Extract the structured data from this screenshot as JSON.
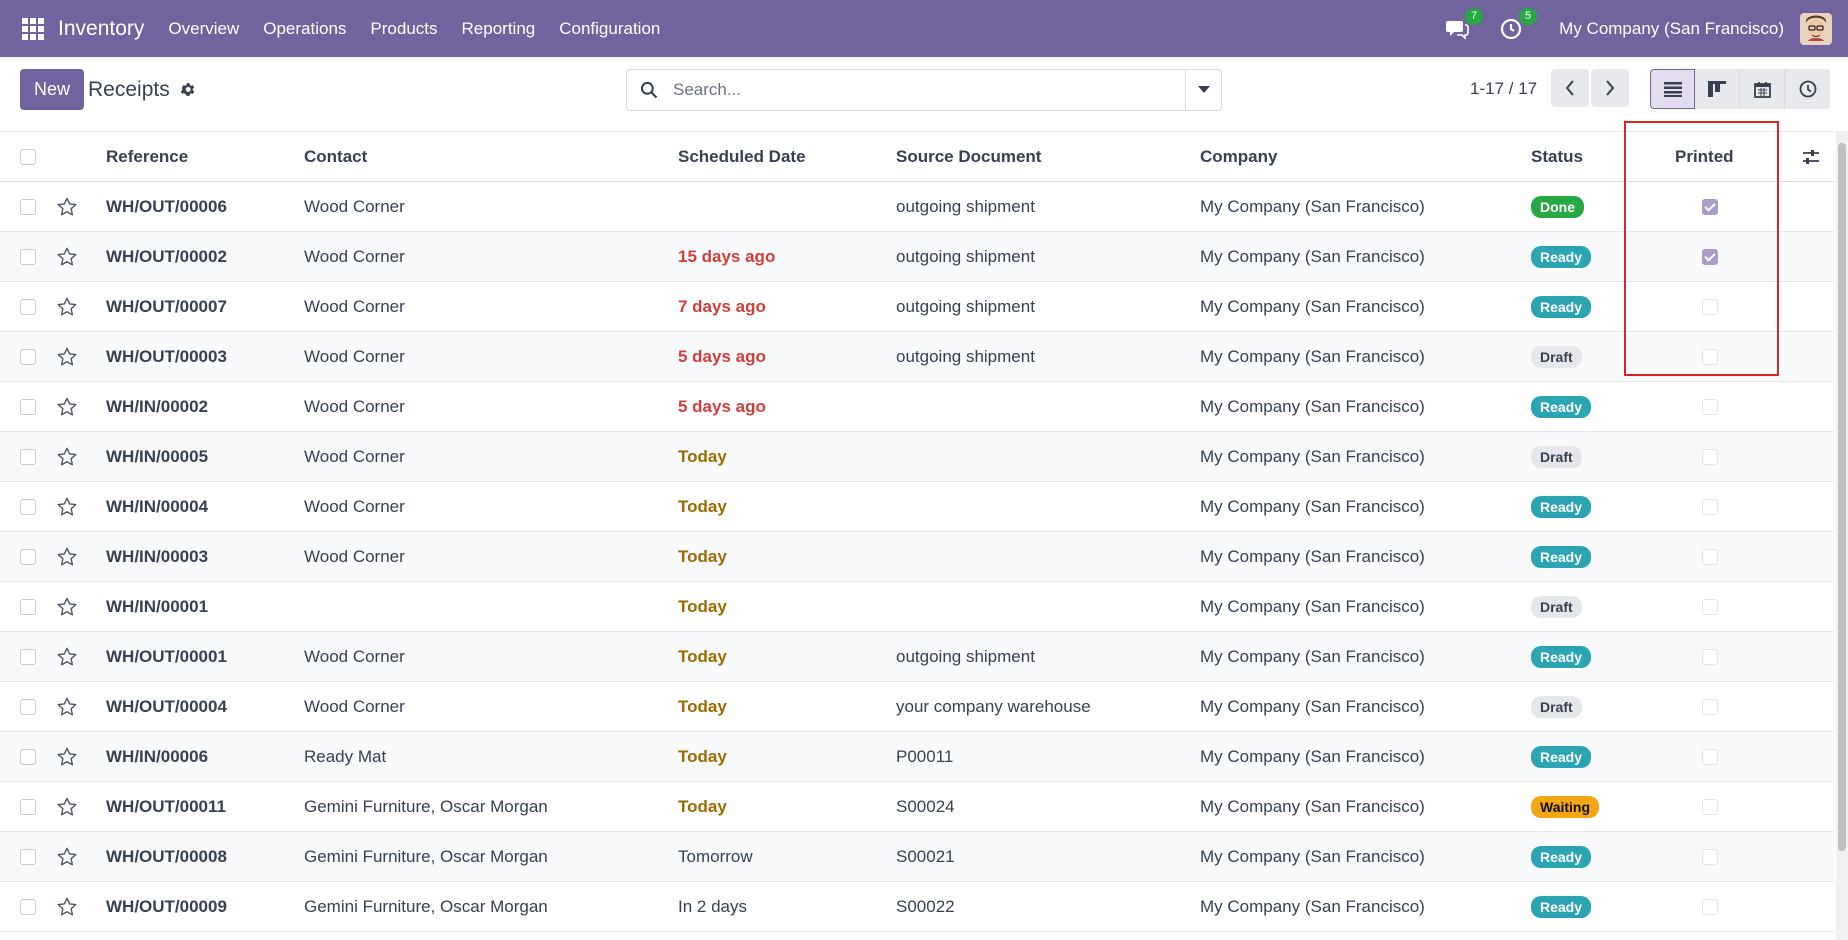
{
  "nav": {
    "app_name": "Inventory",
    "menu": [
      "Overview",
      "Operations",
      "Products",
      "Reporting",
      "Configuration"
    ],
    "messages_count": "7",
    "activities_count": "5",
    "company": "My Company (San Francisco)"
  },
  "control": {
    "new_label": "New",
    "title": "Receipts",
    "search_placeholder": "Search...",
    "pager": "1-17 / 17"
  },
  "columns": {
    "reference": "Reference",
    "contact": "Contact",
    "scheduled_date": "Scheduled Date",
    "source_document": "Source Document",
    "company": "Company",
    "status": "Status",
    "printed": "Printed"
  },
  "colors": {
    "brand": "#71639e",
    "done": "#28a745",
    "ready": "#2ba4b4",
    "waiting": "#f3a712",
    "late": "#d23f3a",
    "today": "#9b6b00"
  },
  "rows": [
    {
      "reference": "WH/OUT/00006",
      "contact": "Wood Corner",
      "date": "",
      "date_type": "none",
      "source": "outgoing shipment",
      "company": "My Company (San Francisco)",
      "status": "Done",
      "printed": true
    },
    {
      "reference": "WH/OUT/00002",
      "contact": "Wood Corner",
      "date": "15 days ago",
      "date_type": "late",
      "source": "outgoing shipment",
      "company": "My Company (San Francisco)",
      "status": "Ready",
      "printed": true
    },
    {
      "reference": "WH/OUT/00007",
      "contact": "Wood Corner",
      "date": "7 days ago",
      "date_type": "late",
      "source": "outgoing shipment",
      "company": "My Company (San Francisco)",
      "status": "Ready",
      "printed": false
    },
    {
      "reference": "WH/OUT/00003",
      "contact": "Wood Corner",
      "date": "5 days ago",
      "date_type": "late",
      "source": "outgoing shipment",
      "company": "My Company (San Francisco)",
      "status": "Draft",
      "printed": false
    },
    {
      "reference": "WH/IN/00002",
      "contact": "Wood Corner",
      "date": "5 days ago",
      "date_type": "late",
      "source": "",
      "company": "My Company (San Francisco)",
      "status": "Ready",
      "printed": false
    },
    {
      "reference": "WH/IN/00005",
      "contact": "Wood Corner",
      "date": "Today",
      "date_type": "today",
      "source": "",
      "company": "My Company (San Francisco)",
      "status": "Draft",
      "printed": false
    },
    {
      "reference": "WH/IN/00004",
      "contact": "Wood Corner",
      "date": "Today",
      "date_type": "today",
      "source": "",
      "company": "My Company (San Francisco)",
      "status": "Ready",
      "printed": false
    },
    {
      "reference": "WH/IN/00003",
      "contact": "Wood Corner",
      "date": "Today",
      "date_type": "today",
      "source": "",
      "company": "My Company (San Francisco)",
      "status": "Ready",
      "printed": false
    },
    {
      "reference": "WH/IN/00001",
      "contact": "",
      "date": "Today",
      "date_type": "today",
      "source": "",
      "company": "My Company (San Francisco)",
      "status": "Draft",
      "printed": false
    },
    {
      "reference": "WH/OUT/00001",
      "contact": "Wood Corner",
      "date": "Today",
      "date_type": "today",
      "source": "outgoing shipment",
      "company": "My Company (San Francisco)",
      "status": "Ready",
      "printed": false
    },
    {
      "reference": "WH/OUT/00004",
      "contact": "Wood Corner",
      "date": "Today",
      "date_type": "today",
      "source": "your company warehouse",
      "company": "My Company (San Francisco)",
      "status": "Draft",
      "printed": false
    },
    {
      "reference": "WH/IN/00006",
      "contact": "Ready Mat",
      "date": "Today",
      "date_type": "today",
      "source": "P00011",
      "company": "My Company (San Francisco)",
      "status": "Ready",
      "printed": false
    },
    {
      "reference": "WH/OUT/00011",
      "contact": "Gemini Furniture, Oscar Morgan",
      "date": "Today",
      "date_type": "today",
      "source": "S00024",
      "company": "My Company (San Francisco)",
      "status": "Waiting",
      "printed": false
    },
    {
      "reference": "WH/OUT/00008",
      "contact": "Gemini Furniture, Oscar Morgan",
      "date": "Tomorrow",
      "date_type": "future",
      "source": "S00021",
      "company": "My Company (San Francisco)",
      "status": "Ready",
      "printed": false
    },
    {
      "reference": "WH/OUT/00009",
      "contact": "Gemini Furniture, Oscar Morgan",
      "date": "In 2 days",
      "date_type": "future",
      "source": "S00022",
      "company": "My Company (San Francisco)",
      "status": "Ready",
      "printed": false
    }
  ]
}
